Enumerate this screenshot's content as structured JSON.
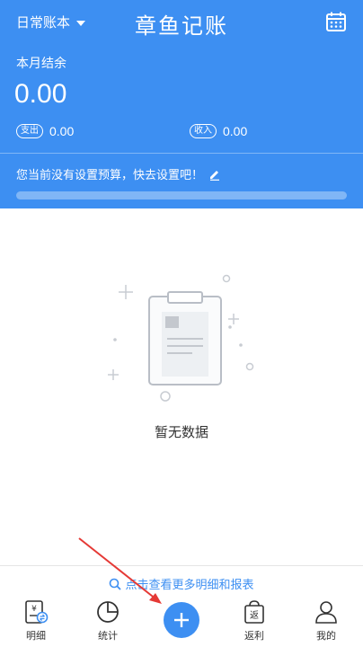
{
  "header": {
    "book_name": "日常账本",
    "app_title": "章鱼记账",
    "month_label": "本月结余",
    "balance": "0.00",
    "expense_label": "支出",
    "expense_value": "0.00",
    "income_label": "收入",
    "income_value": "0.00",
    "budget_prompt": "您当前没有设置预算，快去设置吧！",
    "budget_progress": 0
  },
  "empty_state": {
    "message": "暂无数据"
  },
  "more_link": "点击查看更多明细和报表",
  "tabbar": {
    "items": [
      {
        "label": "明细",
        "icon": "ledger-icon"
      },
      {
        "label": "统计",
        "icon": "pie-chart-icon"
      },
      {
        "label": "",
        "icon": "plus-icon"
      },
      {
        "label": "返利",
        "icon": "shopping-bag-icon"
      },
      {
        "label": "我的",
        "icon": "person-icon"
      }
    ]
  },
  "colors": {
    "primary": "#3d8ff2",
    "annotation_arrow": "#e53935"
  }
}
